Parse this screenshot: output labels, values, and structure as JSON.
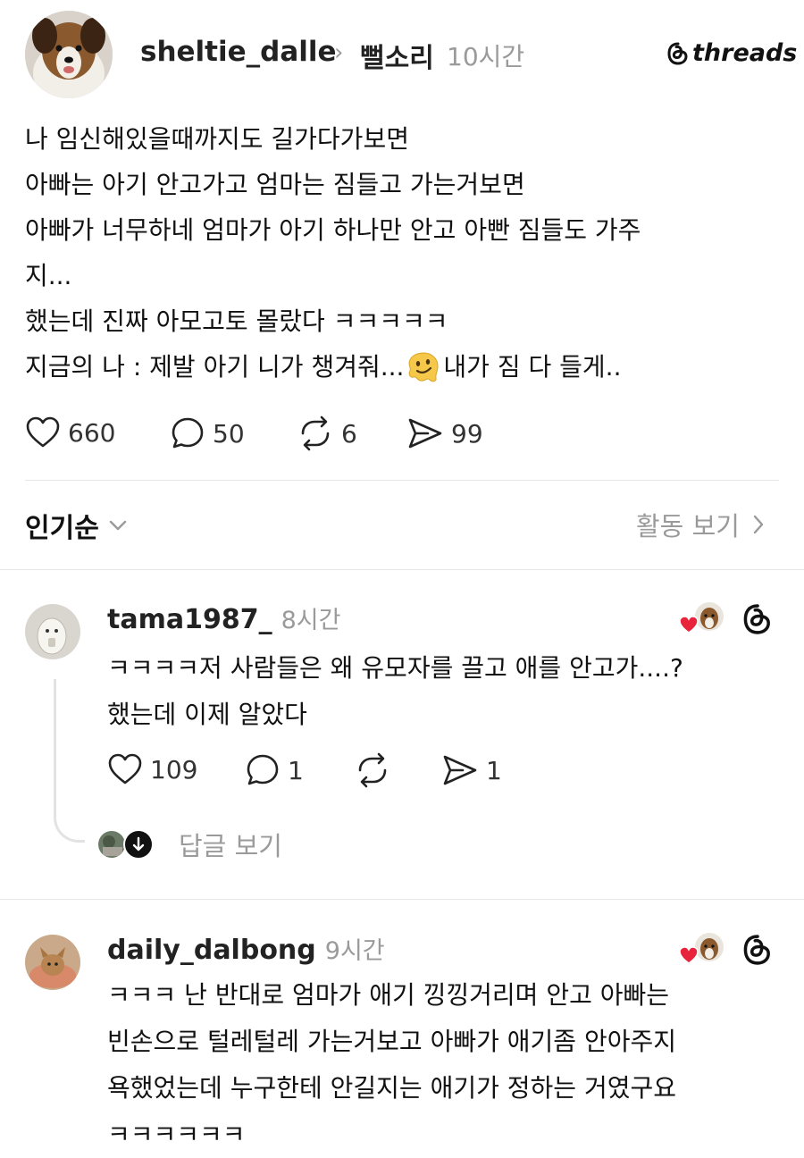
{
  "post": {
    "username": "sheltie_dalle",
    "community": "뻘소리",
    "time": "10시간",
    "brand": "threads",
    "lines": [
      "나 임신해있을때까지도 길가다가보면",
      "아빠는 아기 안고가고  엄마는 짐들고 가는거보면",
      "아빠가 너무하네  엄마가 아기 하나만 안고 아빤 짐들도 가주",
      "지...",
      "했는데 진짜 아모고토 몰랐다 ㅋㅋㅋㅋㅋ"
    ],
    "last_line_a": "지금의 나 : 제발 아기 니가 챙겨줘...",
    "last_line_b": "내가 짐 다 들게..",
    "stats": {
      "likes": "660",
      "comments": "50",
      "reposts": "6",
      "shares": "99"
    }
  },
  "sort": {
    "label": "인기순",
    "activity": "활동 보기"
  },
  "comments": [
    {
      "username": "tama1987_",
      "time": "8시간",
      "lines": [
        "ㅋㅋㅋㅋ저 사람들은 왜 유모자를 끌고 애를 안고가....?",
        "했는데 이제 알았다"
      ],
      "stats": {
        "likes": "109",
        "comments": "1",
        "reposts": "",
        "shares": "1"
      },
      "replies_label": "답글 보기"
    },
    {
      "username": "daily_dalbong",
      "time": "9시간",
      "lines": [
        "ㅋㅋㅋ 난 반대로 엄마가 애기 낑낑거리며 안고 아빠는",
        "빈손으로 털레털레 가는거보고 아빠가 애기좀 안아주지",
        "욕했었는데 누구한테 안길지는 애기가 정하는 거였구요",
        "ㅋㅋㅋㅋㅋㅋ"
      ]
    }
  ],
  "colors": {
    "heart": "#e8243c",
    "muted": "#9a9a9a",
    "text": "#111111"
  }
}
